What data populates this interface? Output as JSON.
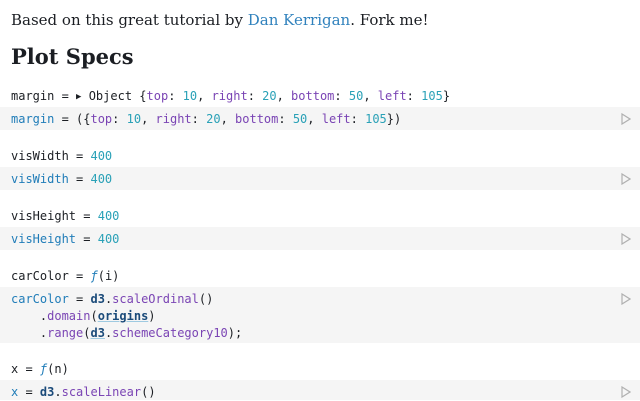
{
  "intro": {
    "prefix": "Based on this great tutorial by ",
    "link": "Dan Kerrigan",
    "suffix": ". Fork me!"
  },
  "heading": "Plot Specs",
  "margin": {
    "output": {
      "name": "margin",
      "eq": " = ",
      "type": "Object ",
      "open": "{",
      "top_k": "top",
      "top_v": "10",
      "right_k": "right",
      "right_v": "20",
      "bottom_k": "bottom",
      "bottom_v": "50",
      "left_k": "left",
      "left_v": "105",
      "close": "}"
    },
    "code": {
      "name": "margin",
      "eq": " = ({",
      "top_k": "top",
      "top_v": "10",
      "right_k": "right",
      "right_v": "20",
      "bottom_k": "bottom",
      "bottom_v": "50",
      "left_k": "left",
      "left_v": "105",
      "close": "})"
    }
  },
  "visWidth": {
    "output": {
      "name": "visWidth",
      "eq": " = ",
      "value": "400"
    },
    "code": {
      "name": "visWidth",
      "eq": " = ",
      "value": "400"
    }
  },
  "visHeight": {
    "output": {
      "name": "visHeight",
      "eq": " = ",
      "value": "400"
    },
    "code": {
      "name": "visHeight",
      "eq": " = ",
      "value": "400"
    }
  },
  "carColor": {
    "output": {
      "name": "carColor",
      "eq": " = ",
      "f": "ƒ",
      "args": "(i)"
    },
    "code": {
      "name": "carColor",
      "eq": " = ",
      "d3": "d3",
      "dot": ".",
      "method": "scaleOrdinal",
      "call": "()",
      "l2_dot": "    .",
      "l2_method": "domain",
      "l2_open": "(",
      "l2_arg": "origins",
      "l2_close": ")",
      "l3_dot": "    .",
      "l3_method": "range",
      "l3_open": "(",
      "l3_d3": "d3",
      "l3_dot2": ".",
      "l3_arg": "schemeCategory10",
      "l3_close": ");"
    }
  },
  "x": {
    "output": {
      "name": "x",
      "eq": " = ",
      "f": "ƒ",
      "args": "(n)"
    },
    "code": {
      "name": "x",
      "eq": " = ",
      "d3": "d3",
      "dot": ".",
      "method": "scaleLinear",
      "call": "()"
    }
  },
  "icons": {
    "run": "play-triangle",
    "expand": "disclosure-triangle"
  },
  "colors": {
    "link": "#3182bd",
    "variable": "#1f7cb8",
    "number": "#2aa1b7",
    "keyword": "#7a44b4",
    "cell_bg": "#f5f5f5"
  }
}
